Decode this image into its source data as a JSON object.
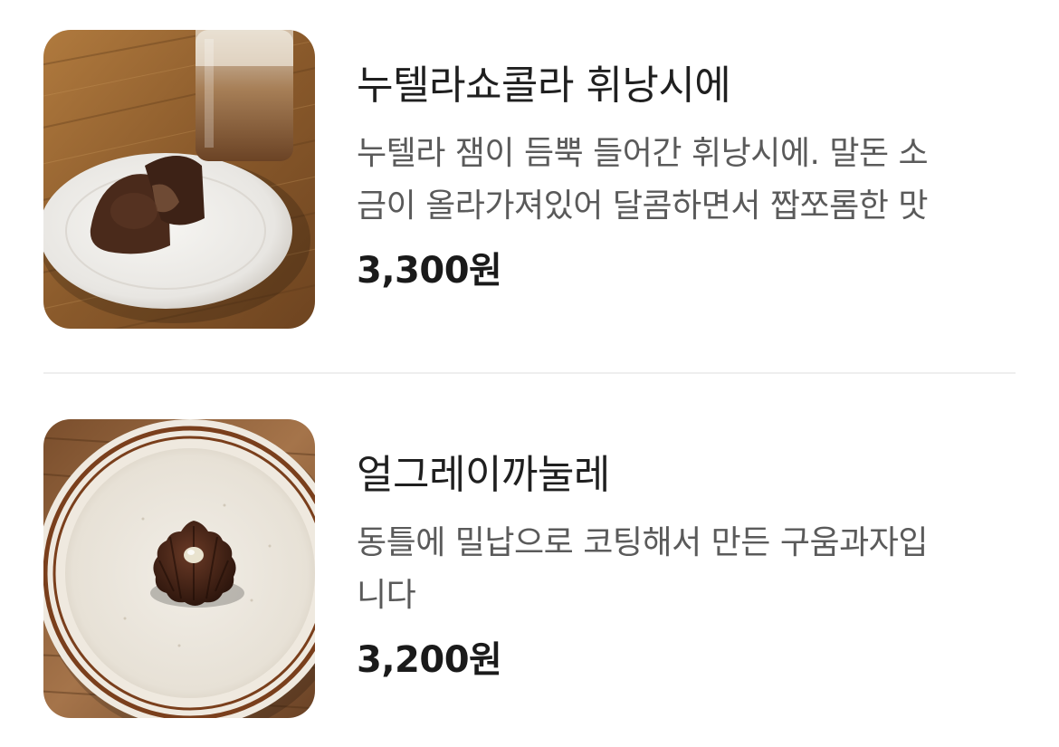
{
  "items": [
    {
      "name": "누텔라쇼콜라 휘낭시에",
      "description_lines": [
        "누텔라 잼이 듬뿍 들어간 휘낭시에. 말돈 소",
        "금이 올라가져있어 달콤하면서 짭쪼롬한 맛"
      ],
      "price": "3,300원"
    },
    {
      "name": "얼그레이까눌레",
      "description_lines": [
        "동틀에 밀납으로 코팅해서 만든 구움과자입",
        "니다"
      ],
      "price": "3,200원"
    }
  ]
}
